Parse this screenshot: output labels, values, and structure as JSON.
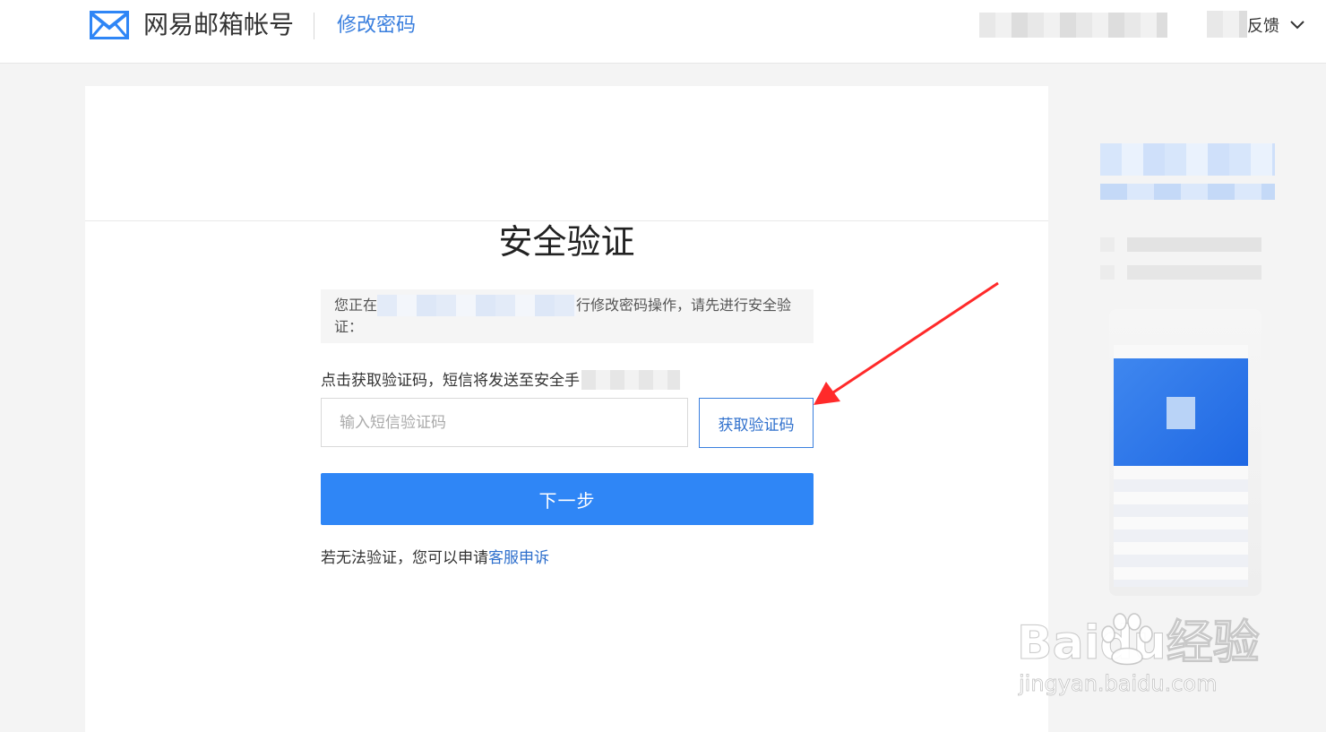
{
  "header": {
    "brand": "网易邮箱帐号",
    "page_name": "修改密码",
    "feedback": "反馈"
  },
  "main": {
    "title": "安全验证",
    "notice_prefix": "您正在",
    "notice_suffix": "行修改密码操作，请先进行安全验证：",
    "sms_hint": "点击获取验证码，短信将发送至安全手",
    "code_input": {
      "value": "",
      "placeholder": "输入短信验证码"
    },
    "get_code_label": "获取验证码",
    "next_label": "下一步",
    "appeal_text": "若无法验证，您可以申请",
    "appeal_link": "客服申诉"
  },
  "watermark": {
    "main": "Baidu经验",
    "sub": "jingyan.baidu.com"
  },
  "colors": {
    "accent": "#2f86f6",
    "link": "#2e6fcc",
    "annotation_arrow": "#ff2a2a"
  }
}
